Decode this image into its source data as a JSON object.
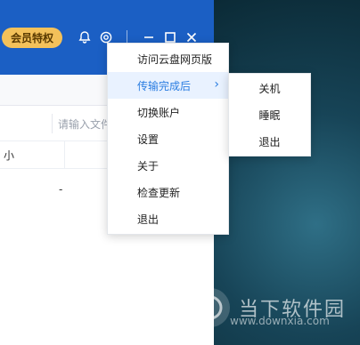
{
  "titlebar": {
    "vip_label": "会员特权"
  },
  "search": {
    "placeholder": "请输入文件"
  },
  "table": {
    "col_size": "小",
    "row_value": "-"
  },
  "menu": {
    "items": [
      {
        "label": "访问云盘网页版"
      },
      {
        "label": "传输完成后"
      },
      {
        "label": "切换账户"
      },
      {
        "label": "设置"
      },
      {
        "label": "关于"
      },
      {
        "label": "检查更新"
      },
      {
        "label": "退出"
      }
    ],
    "submenu": [
      {
        "label": "关机"
      },
      {
        "label": "睡眠"
      },
      {
        "label": "退出"
      }
    ]
  },
  "watermark": {
    "text": "当下软件园",
    "url": "www.downxia.com"
  },
  "colors": {
    "titlebar": "#1b5fc4",
    "accent": "#2a7de1",
    "vip": "#f3c15a"
  },
  "icons": {
    "bell": "bell-icon",
    "settings": "gear-icon",
    "minimize": "minimize-icon",
    "maximize": "maximize-icon",
    "close": "close-icon",
    "submenu_arrow": "chevron-right-icon"
  }
}
